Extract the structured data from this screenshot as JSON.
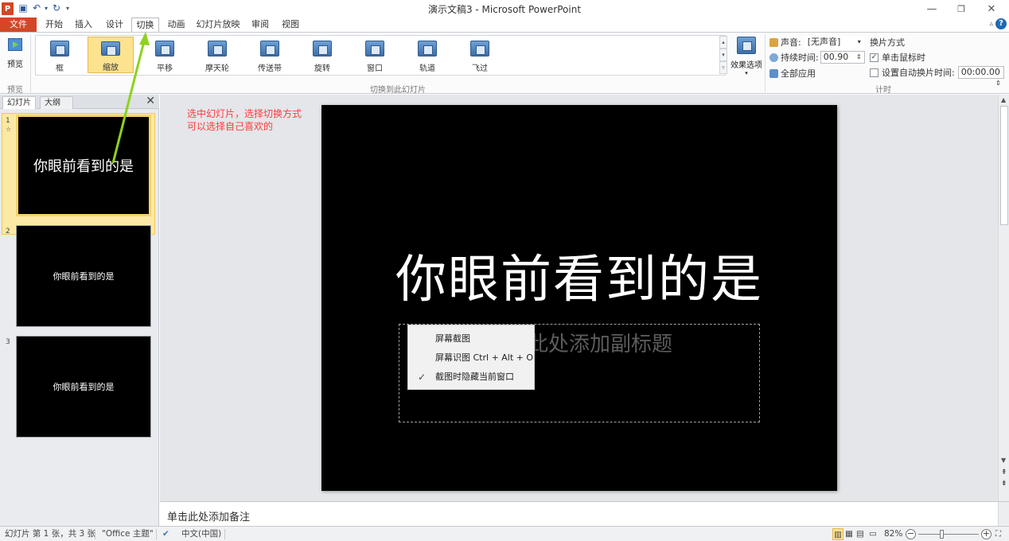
{
  "window": {
    "title": "演示文稿3 - Microsoft PowerPoint",
    "app_icon": "powerpoint-icon",
    "minimize_glyph": "—",
    "restore_glyph": "❐",
    "close_glyph": "✕"
  },
  "quick_access": {
    "save_icon": "save-icon",
    "undo_icon": "undo-icon",
    "redo_icon": "redo-icon",
    "customize_icon": "dropdown-icon"
  },
  "tabs": [
    "文件",
    "开始",
    "插入",
    "设计",
    "切换",
    "动画",
    "幻灯片放映",
    "审阅",
    "视图"
  ],
  "active_tab": "切换",
  "ribbon": {
    "preview": {
      "label": "预览",
      "group": "预览"
    },
    "transitions": [
      {
        "label": "框",
        "selected": false
      },
      {
        "label": "缩放",
        "selected": true
      },
      {
        "label": "平移",
        "selected": false
      },
      {
        "label": "摩天轮",
        "selected": false
      },
      {
        "label": "传送带",
        "selected": false
      },
      {
        "label": "旋转",
        "selected": false
      },
      {
        "label": "窗口",
        "selected": false
      },
      {
        "label": "轨道",
        "selected": false
      },
      {
        "label": "飞过",
        "selected": false
      }
    ],
    "transitions_group": "切换到此幻灯片",
    "effect_options": "效果选项",
    "timing": {
      "sound_label": "声音:",
      "sound_value": "[无声音]",
      "duration_label": "持续时间:",
      "duration_value": "00.90",
      "apply_all": "全部应用",
      "advance_title": "换片方式",
      "on_click_label": "单击鼠标时",
      "on_click_checked": true,
      "after_label": "设置自动换片时间:",
      "after_value": "00:00.00",
      "after_checked": false,
      "group": "计时"
    }
  },
  "pane": {
    "tabs": [
      "幻灯片",
      "大纲"
    ],
    "close_glyph": "✕",
    "slides": [
      {
        "number": "1",
        "text": "你眼前看到的是",
        "selected": true
      },
      {
        "number": "2",
        "text": "你眼前看到的是",
        "selected": false
      },
      {
        "number": "3",
        "text": "你眼前看到的是",
        "selected": false
      }
    ]
  },
  "annotation": {
    "line1": "选中幻灯片，选择切换方式",
    "line2": "可以选择自己喜欢的"
  },
  "slide": {
    "title": "你眼前看到的是",
    "subtitle_placeholder": "单击此处添加副标题"
  },
  "context_menu": [
    {
      "label": "屏幕截图",
      "checked": false
    },
    {
      "label": "屏幕识图 Ctrl + Alt + O",
      "checked": false
    },
    {
      "label": "截图时隐藏当前窗口",
      "checked": true
    }
  ],
  "notes_placeholder": "单击此处添加备注",
  "status": {
    "slide_info": "幻灯片 第 1 张，共 3 张",
    "theme": "\"Office 主题\"",
    "language": "中文(中国)",
    "zoom": "82%",
    "zoom_value": 0.82
  },
  "colors": {
    "file_tab": "#d24726",
    "annotation": "#ff3b3b",
    "arrow": "#8ed11f",
    "selected": "#fde28f"
  }
}
